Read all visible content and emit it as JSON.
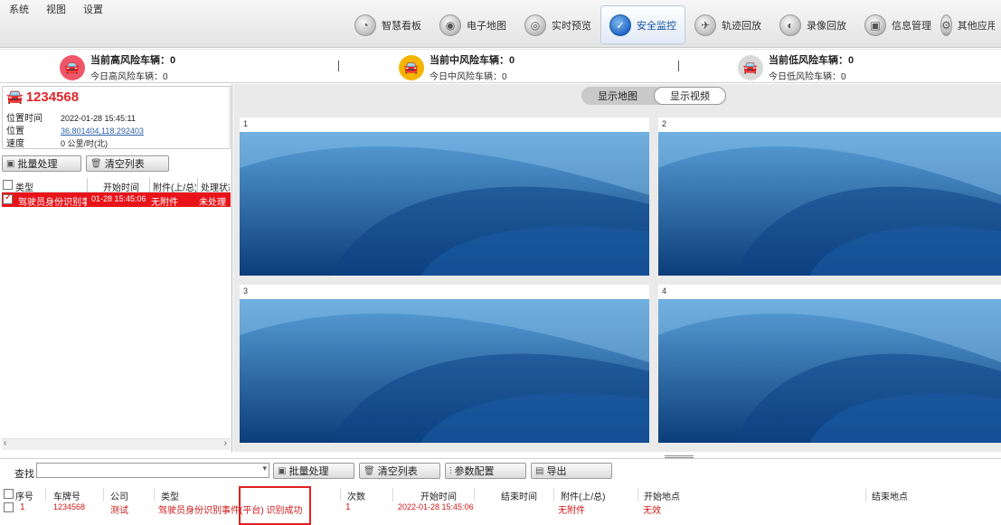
{
  "menu": [
    "系统",
    "视图",
    "设置"
  ],
  "nav": [
    {
      "label": "智慧看板",
      "icon": "dashboard-icon",
      "glyph": "◔",
      "active": false
    },
    {
      "label": "电子地图",
      "icon": "map-icon",
      "glyph": "◉",
      "active": false
    },
    {
      "label": "实时预览",
      "icon": "camera-icon",
      "glyph": "◎",
      "active": false
    },
    {
      "label": "安全监控",
      "icon": "shield-icon",
      "glyph": "✓",
      "active": true
    },
    {
      "label": "轨迹回放",
      "icon": "track-icon",
      "glyph": "✈",
      "active": false
    },
    {
      "label": "录像回放",
      "icon": "video-replay-icon",
      "glyph": "◐",
      "active": false
    },
    {
      "label": "信息管理",
      "icon": "info-manage-icon",
      "glyph": "▣",
      "active": false
    },
    {
      "label": "其他应用",
      "icon": "other-apps-icon",
      "glyph": "⚙",
      "active": false
    }
  ],
  "risk": {
    "high": {
      "title": "当前高风险车辆：",
      "count": "0",
      "sub": "今日高风险车辆：",
      "sub_count": "0",
      "color": "#f0566a"
    },
    "mid": {
      "title": "当前中风险车辆：",
      "count": "0",
      "sub": "今日中风险车辆：",
      "sub_count": "0",
      "color": "#f5b400"
    },
    "low": {
      "title": "当前低风险车辆：",
      "count": "0",
      "sub": "今日低风险车辆：",
      "sub_count": "0",
      "color": "#d9d9d9"
    }
  },
  "vehicle": {
    "plate": "1234568",
    "time_label": "位置时间",
    "time": "2022-01-28 15:45:11",
    "pos_label": "位置",
    "pos": "36.801404,118.292403",
    "speed_label": "速度",
    "speed": "0 公里/时(北)"
  },
  "left_toolbar": {
    "batch": "批量处理",
    "clear": "清空列表"
  },
  "alarm_table": {
    "headers": [
      "类型",
      "开始时间",
      "附件(上/总)",
      "处理状态"
    ],
    "rows": [
      {
        "type": "驾驶员身份识别事件",
        "start": "01-28 15:45:06",
        "attach": "无附件",
        "status": "未处理"
      }
    ]
  },
  "view_toggle": {
    "map": "显示地图",
    "video": "显示视频"
  },
  "video_cells": [
    "1",
    "2",
    "3",
    "4"
  ],
  "bottom": {
    "search_label": "查找",
    "search_value": "",
    "buttons": {
      "batch": "批量处理",
      "clear": "清空列表",
      "params": "参数配置",
      "export": "导出"
    },
    "headers": [
      "序号",
      "车牌号",
      "公司",
      "类型",
      "次数",
      "开始时间",
      "结束时间",
      "附件(上/总)",
      "开始地点",
      "结束地点"
    ],
    "rows": [
      {
        "idx": "1",
        "plate": "1234568",
        "company": "测试",
        "type": "驾驶员身份识别事件(平台) 识别成功",
        "count": "1",
        "start": "2022-01-28 15:45:06",
        "end": "",
        "attach": "无附件",
        "start_loc": "无效",
        "end_loc": ""
      }
    ]
  }
}
